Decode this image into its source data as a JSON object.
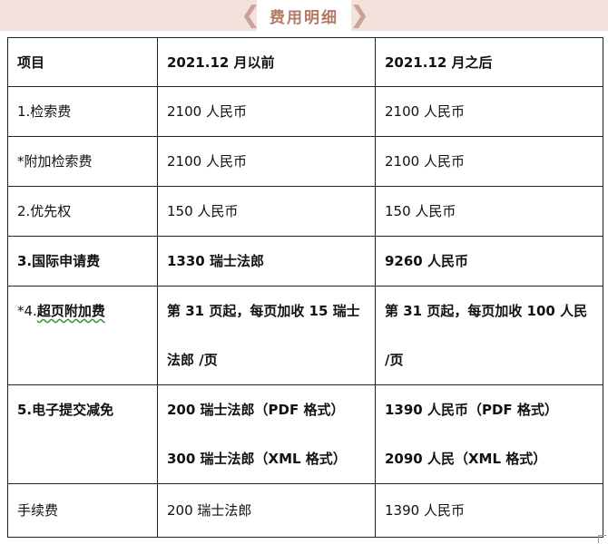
{
  "banner": {
    "title": "费用明细"
  },
  "table": {
    "header": [
      "项目",
      "2021.12 月以前",
      "2021.12 月之后"
    ],
    "rows": [
      {
        "item": "1.检索费",
        "before": "2100 人民币",
        "after": "2100 人民币"
      },
      {
        "item": "*附加检索费",
        "before": "2100 人民币",
        "after": "2100 人民币"
      },
      {
        "item": "2.优先权",
        "before": "150 人民币",
        "after": "150 人民币"
      },
      {
        "item": "3.国际申请费",
        "before": "1330 瑞士法郎",
        "after": "9260 人民币"
      },
      {
        "item_prefix": "*4.",
        "item_underlined": "超页附加费",
        "before_line1": "第 31 页起，每页加收 15 瑞士",
        "before_line2": "法郎 /页",
        "after_line1": "第 31 页起，每页加收 100 人民",
        "after_line2": "/页"
      },
      {
        "item": "5.电子提交减免",
        "before_line1": "200 瑞士法郎（PDF 格式）",
        "before_line2": "300 瑞士法郎（XML 格式）",
        "after_line1": "1390 人民币（PDF 格式）",
        "after_line2": "2090  人民（XML 格式）"
      },
      {
        "item": "手续费",
        "before": "200 瑞士法郎",
        "after": "1390 人民币"
      }
    ]
  },
  "icons": {
    "banner_left": "chevron-left-ornament-icon",
    "banner_right": "chevron-right-ornament-icon"
  },
  "colors": {
    "banner_bg": "#f3e2dc",
    "banner_text": "#b47a66",
    "border": "#222222"
  }
}
